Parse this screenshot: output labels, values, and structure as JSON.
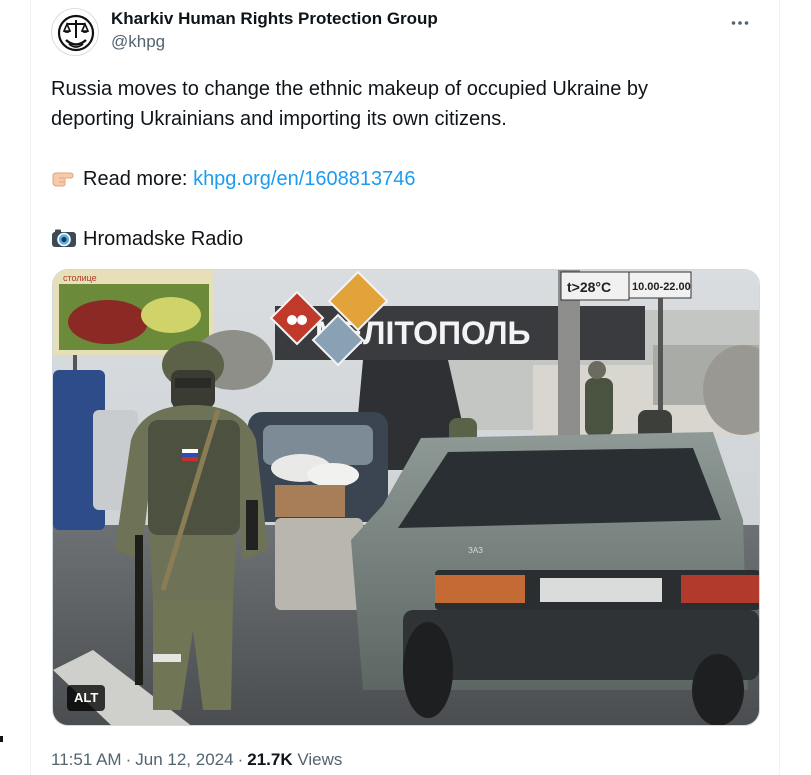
{
  "tweet": {
    "author": {
      "display_name": "Kharkiv Human Rights Protection Group",
      "handle": "@khpg",
      "avatar_icon": "khpg-logo-icon"
    },
    "more_icon": "more-horizontal-icon",
    "lines": [
      "Russia moves to change the ethnic makeup of occupied Ukraine by",
      "deporting Ukrainians and importing its own citizens."
    ],
    "read_more": {
      "emoji_icon": "pointing-hand-icon",
      "label": "Read more:",
      "link_text": "khpg.org/en/1608813746"
    },
    "credit": {
      "emoji_icon": "camera-icon",
      "text": "Hromadske Radio"
    },
    "media": {
      "alt_label": "ALT",
      "sign_text": "МЕЛІТОПОЛЬ",
      "temp_sign": "t>28°C",
      "time_sign": "10.00-22.00",
      "billboard_text": "столице"
    },
    "timestamp": {
      "time": "11:51 AM",
      "date": "Jun 12, 2024",
      "views_count": "21.7K",
      "views_label": "Views"
    }
  }
}
